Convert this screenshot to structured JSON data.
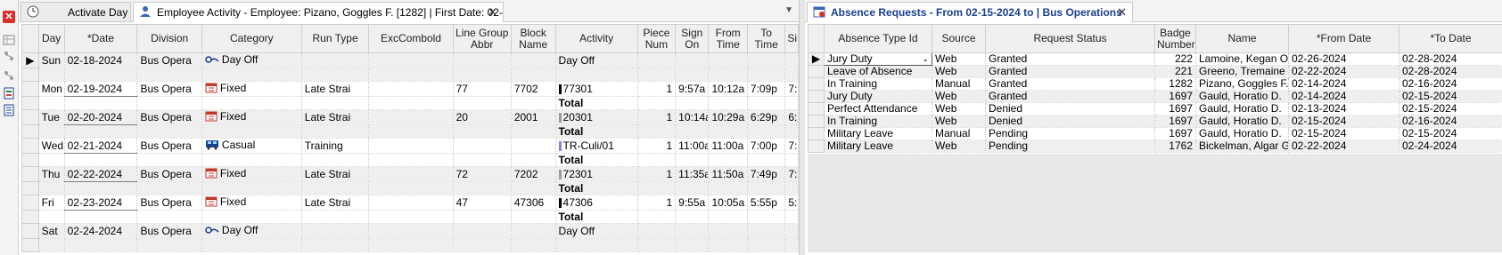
{
  "left_pane": {
    "tabs": [
      {
        "label": "Activate Day",
        "icon": "clock-icon"
      },
      {
        "label": "Employee Activity - Employee: Pizano, Goggles F. [1282] | First Date: 02-...",
        "icon": "person-activity-icon"
      }
    ],
    "grid": {
      "columns": [
        "Day",
        "*Date",
        "Division",
        "Category",
        "Run Type",
        "ExcCombold",
        "Line Group Abbr",
        "Block Name",
        "Activity",
        "Piece Num",
        "Sign On",
        "From Time",
        "To Time",
        "Si"
      ],
      "rows": [
        {
          "day": "Sun",
          "date": "02-18-2024",
          "division": "Bus Opera",
          "category": "Day Off",
          "cat_icon": "day-off-icon",
          "run_type": "",
          "exc": "",
          "lga": "",
          "block": "",
          "activity": "Day Off",
          "piece": "",
          "sign_on": "",
          "from": "",
          "to": "",
          "si": "",
          "total": false
        },
        {
          "day": "Mon",
          "date": "02-19-2024",
          "division": "Bus Opera",
          "category": "Fixed",
          "cat_icon": "fixed-schedule-icon",
          "run_type": "Late Strai",
          "exc": "",
          "lga": "77",
          "block": "7702",
          "activity": "77301",
          "piece": "1",
          "sign_on": "9:57a",
          "from": "10:12a",
          "to": "7:09p",
          "si": "7:",
          "total": true
        },
        {
          "day": "Tue",
          "date": "02-20-2024",
          "division": "Bus Opera",
          "category": "Fixed",
          "cat_icon": "fixed-schedule-icon",
          "run_type": "Late Strai",
          "exc": "",
          "lga": "20",
          "block": "2001",
          "activity": "20301",
          "piece": "1",
          "sign_on": "10:14a",
          "from": "10:29a",
          "to": "6:29p",
          "si": "6:",
          "total": true
        },
        {
          "day": "Wed",
          "date": "02-21-2024",
          "division": "Bus Opera",
          "category": "Casual",
          "cat_icon": "bus-icon",
          "run_type": "Training",
          "exc": "",
          "lga": "",
          "block": "",
          "activity": "TR-Culi/01",
          "piece": "1",
          "sign_on": "11:00a",
          "from": "11:00a",
          "to": "7:00p",
          "si": "7:",
          "total": true
        },
        {
          "day": "Thu",
          "date": "02-22-2024",
          "division": "Bus Opera",
          "category": "Fixed",
          "cat_icon": "fixed-schedule-icon",
          "run_type": "Late Strai",
          "exc": "",
          "lga": "72",
          "block": "7202",
          "activity": "72301",
          "piece": "1",
          "sign_on": "11:35a",
          "from": "11:50a",
          "to": "7:49p",
          "si": "7:",
          "total": true
        },
        {
          "day": "Fri",
          "date": "02-23-2024",
          "division": "Bus Opera",
          "category": "Fixed",
          "cat_icon": "fixed-schedule-icon",
          "run_type": "Late Strai",
          "exc": "",
          "lga": "47",
          "block": "47306",
          "activity": "47306",
          "piece": "1",
          "sign_on": "9:55a",
          "from": "10:05a",
          "to": "5:55p",
          "si": "5:",
          "total": true
        },
        {
          "day": "Sat",
          "date": "02-24-2024",
          "division": "Bus Opera",
          "category": "Day Off",
          "cat_icon": "day-off-icon",
          "run_type": "",
          "exc": "",
          "lga": "",
          "block": "",
          "activity": "Day Off",
          "piece": "",
          "sign_on": "",
          "from": "",
          "to": "",
          "si": "",
          "total": false
        }
      ],
      "total_label": "Total"
    }
  },
  "right_pane": {
    "tab": {
      "label": "Absence Requests - From 02-15-2024 to  | Bus Operations",
      "icon": "absence-calendar-icon"
    },
    "grid": {
      "columns": [
        "Absence Type Id",
        "Source",
        "Request Status",
        "Badge Number",
        "Name",
        "*From Date",
        "*To Date"
      ],
      "rows": [
        {
          "type": "Jury Duty",
          "source": "Web",
          "status": "Granted",
          "badge": "222",
          "name": "Lamoine, Kegan O.",
          "from": "02-26-2024",
          "to": "02-28-2024"
        },
        {
          "type": "Leave of Absence",
          "source": "Web",
          "status": "Granted",
          "badge": "221",
          "name": "Greeno, Tremaine V.",
          "from": "02-22-2024",
          "to": "02-28-2024"
        },
        {
          "type": "In Training",
          "source": "Manual",
          "status": "Granted",
          "badge": "1282",
          "name": "Pizano, Goggles F.",
          "from": "02-14-2024",
          "to": "02-16-2024"
        },
        {
          "type": "Jury Duty",
          "source": "Web",
          "status": "Granted",
          "badge": "1697",
          "name": "Gauld, Horatio D.",
          "from": "02-14-2024",
          "to": "02-15-2024"
        },
        {
          "type": "Perfect Attendance",
          "source": "Web",
          "status": "Denied",
          "badge": "1697",
          "name": "Gauld, Horatio D.",
          "from": "02-13-2024",
          "to": "02-15-2024"
        },
        {
          "type": "In Training",
          "source": "Web",
          "status": "Denied",
          "badge": "1697",
          "name": "Gauld, Horatio D.",
          "from": "02-15-2024",
          "to": "02-16-2024"
        },
        {
          "type": "Military Leave",
          "source": "Manual",
          "status": "Pending",
          "badge": "1697",
          "name": "Gauld, Horatio D.",
          "from": "02-15-2024",
          "to": "02-15-2024"
        },
        {
          "type": "Military Leave",
          "source": "Web",
          "status": "Pending",
          "badge": "1762",
          "name": "Bickelman, Algar G.",
          "from": "02-22-2024",
          "to": "02-24-2024"
        }
      ]
    }
  },
  "colors": {
    "accent_blue": "#1a3f8f",
    "close_red": "#d9302c",
    "activity_dark": "#000000",
    "activity_light": "#9a9a9a",
    "activity_purple": "#8a7fd9"
  }
}
